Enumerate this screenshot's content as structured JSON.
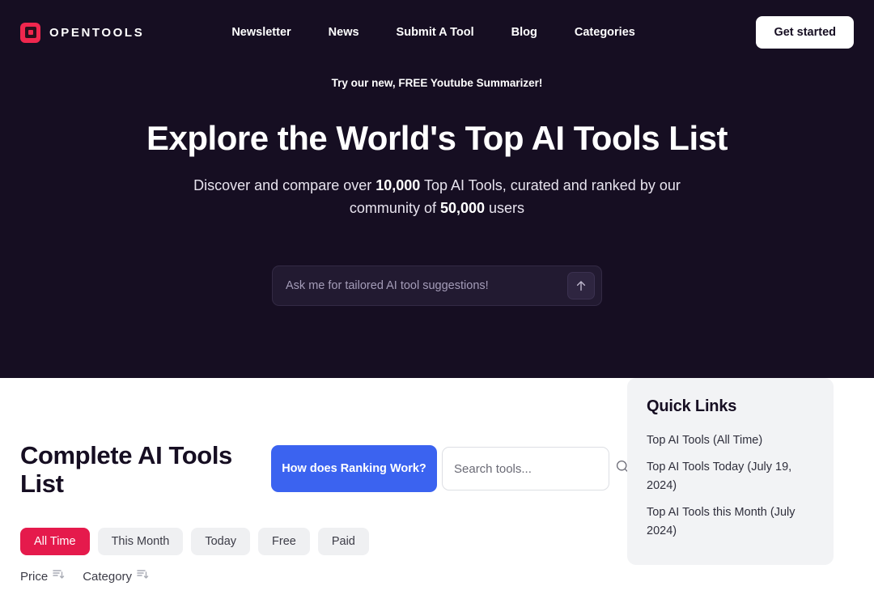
{
  "header": {
    "brand_name": "OPENTOOLS",
    "logo_color": "#F0274E",
    "nav": [
      {
        "label": "Newsletter"
      },
      {
        "label": "News"
      },
      {
        "label": "Submit A Tool"
      },
      {
        "label": "Blog"
      },
      {
        "label": "Categories"
      }
    ],
    "cta_label": "Get started"
  },
  "hero": {
    "background": "#160E22",
    "announcement": "Try our new, FREE Youtube Summarizer!",
    "title": "Explore the World's Top AI Tools List",
    "subtitle_part1": "Discover and compare over ",
    "subtitle_bold1": "10,000",
    "subtitle_part2": " Top AI Tools, curated and ranked by our community of ",
    "subtitle_bold2": "50,000",
    "subtitle_part3": " users",
    "chat_placeholder": "Ask me for tailored AI tool suggestions!",
    "chat_value": "",
    "send_icon": "arrow-up-icon"
  },
  "main": {
    "page_title": "Complete AI Tools List",
    "ranking_button": "How does Ranking Work?",
    "search_placeholder": "Search tools...",
    "search_value": "",
    "search_icon": "search-icon",
    "accent_blue": "#3B63F0",
    "accent_red": "#E51A4C",
    "filters": [
      {
        "label": "All Time",
        "active": true
      },
      {
        "label": "This Month",
        "active": false
      },
      {
        "label": "Today",
        "active": false
      },
      {
        "label": "Free",
        "active": false
      },
      {
        "label": "Paid",
        "active": false
      }
    ],
    "sorts": [
      {
        "label": "Price",
        "icon": "sort-descending-icon"
      },
      {
        "label": "Category",
        "icon": "sort-descending-icon"
      }
    ]
  },
  "quick_links": {
    "title": "Quick Links",
    "links": [
      {
        "label": "Top AI Tools (All Time)"
      },
      {
        "label": "Top AI Tools Today (July 19, 2024)"
      },
      {
        "label": "Top AI Tools this Month (July 2024)"
      }
    ]
  }
}
